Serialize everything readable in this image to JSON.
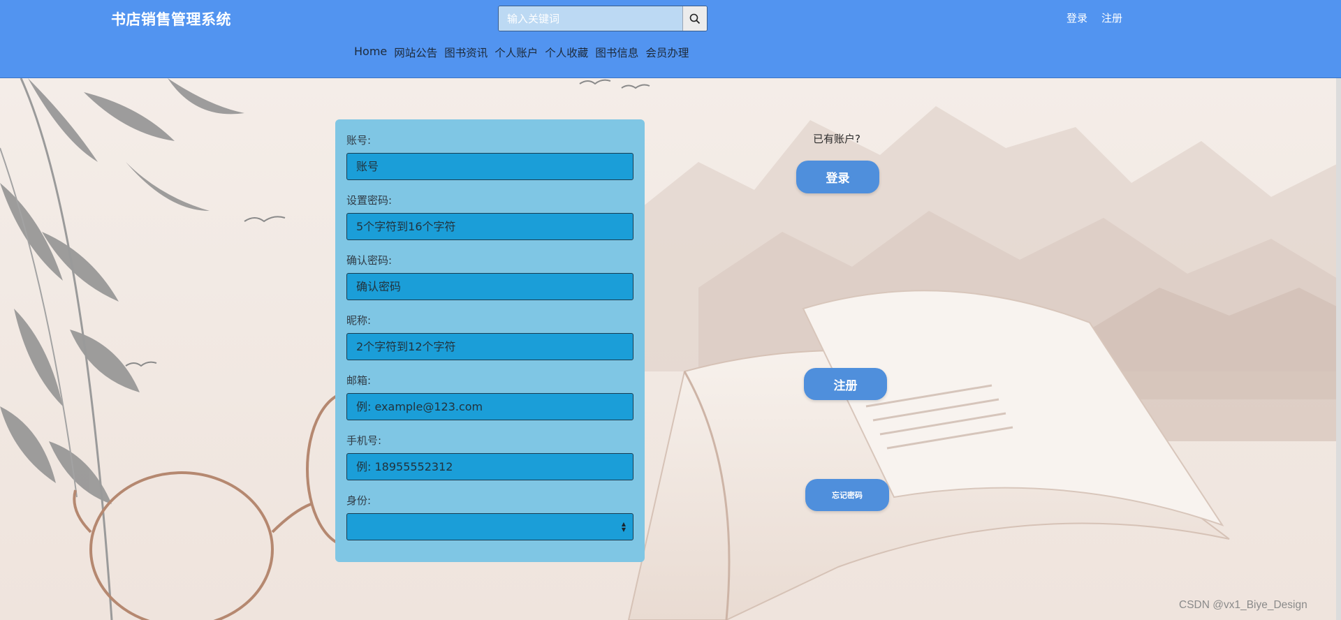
{
  "header": {
    "brand": "书店销售管理系统",
    "search_placeholder": "输入关键词",
    "login_link": "登录",
    "register_link": "注册"
  },
  "nav": {
    "items": [
      "Home",
      "网站公告",
      "图书资讯",
      "个人账户",
      "个人收藏",
      "图书信息",
      "会员办理"
    ]
  },
  "form": {
    "fields": [
      {
        "label": "账号:",
        "placeholder": "账号"
      },
      {
        "label": "设置密码:",
        "placeholder": "5个字符到16个字符"
      },
      {
        "label": "确认密码:",
        "placeholder": "确认密码"
      },
      {
        "label": "昵称:",
        "placeholder": "2个字符到12个字符"
      },
      {
        "label": "邮箱:",
        "placeholder": "例: example@123.com"
      },
      {
        "label": "手机号:",
        "placeholder": "例: 18955552312"
      }
    ],
    "role_label": "身份:",
    "role_value": ""
  },
  "side": {
    "have_account": "已有账户?",
    "login_button": "登录",
    "register_button": "注册",
    "forgot_button": "忘记密码"
  },
  "watermark": "CSDN @vx1_Biye_Design",
  "colors": {
    "header_bg": "#5294f0",
    "card_bg": "#7fc6e4",
    "field_bg": "#1b9ed8",
    "button_bg": "#4f8fdc"
  }
}
